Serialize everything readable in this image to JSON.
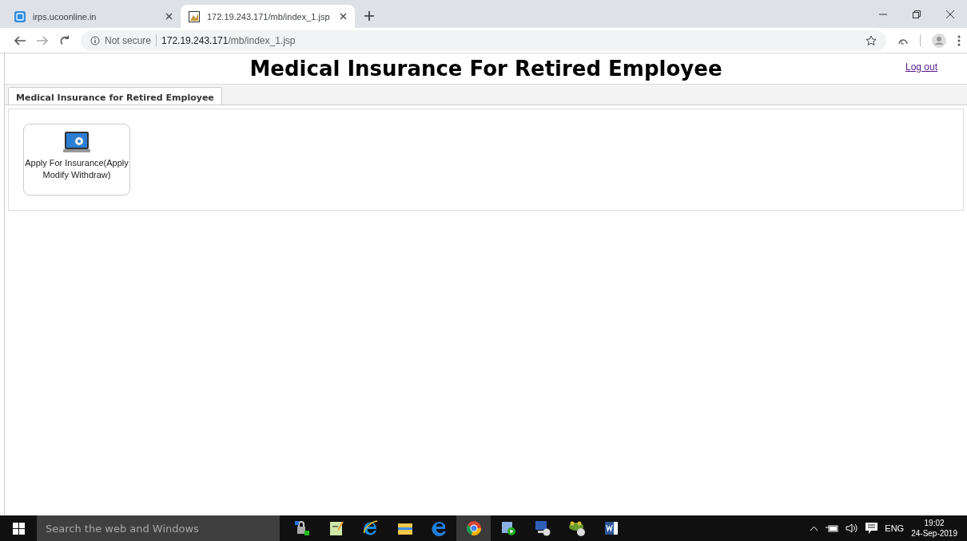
{
  "browser": {
    "tabs": [
      {
        "title": "irps.ucoonline.in",
        "selected": false,
        "kind": "site"
      },
      {
        "title": "172.19.243.171/mb/index_1.jsp",
        "selected": true,
        "kind": "page"
      }
    ],
    "security": "Not secure",
    "url_host": "172.19.243.171",
    "url_path": "/mb/index_1.jsp"
  },
  "page": {
    "title": "Medical Insurance For Retired Employee",
    "logout": "Log out",
    "tabs": [
      {
        "label": "Medical Insurance for Retired Employee",
        "selected": true
      }
    ],
    "tiles": [
      {
        "label": "Apply For Insurance(Apply Modify Withdraw)"
      }
    ]
  },
  "taskbar": {
    "search_placeholder": "Search the web and Windows",
    "apps": [
      {
        "kind": "lock",
        "active": false
      },
      {
        "kind": "notepad",
        "active": false
      },
      {
        "kind": "ie",
        "active": false
      },
      {
        "kind": "folder",
        "active": false
      },
      {
        "kind": "edge",
        "active": false
      },
      {
        "kind": "chrome",
        "active": true
      },
      {
        "kind": "media",
        "active": false
      },
      {
        "kind": "remote",
        "active": false
      },
      {
        "kind": "frog",
        "active": false
      },
      {
        "kind": "word",
        "active": false
      }
    ],
    "language": "ENG",
    "time": "19:02",
    "date": "24-Sep-2019"
  }
}
